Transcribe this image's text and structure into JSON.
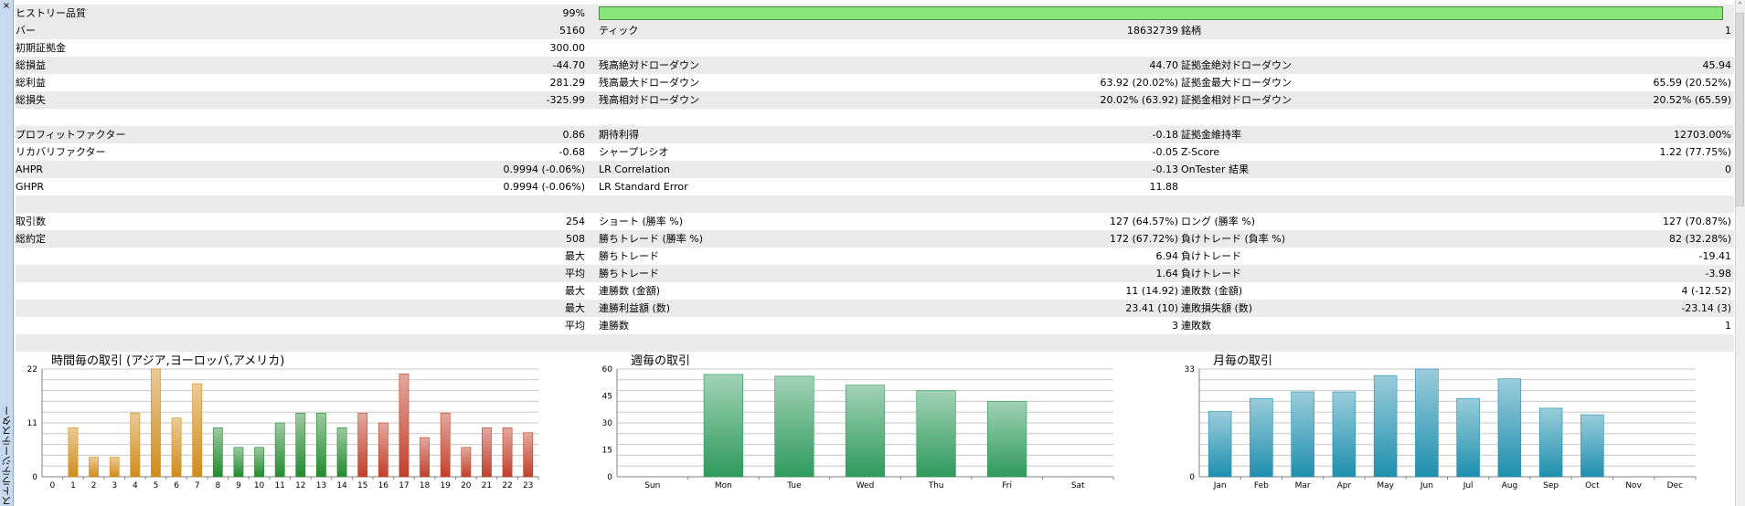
{
  "window": {
    "vertical_title": "ストラテジーテスター",
    "close_glyph": "×",
    "scroll_glyph": "⌃"
  },
  "stats": {
    "rows": [
      {
        "shade": true,
        "l1": "ヒストリー品質",
        "v1": "99%",
        "l2": "",
        "v2": "",
        "l3": "",
        "v3": "",
        "quality_bar": 99
      },
      {
        "shade": true,
        "l1": "バー",
        "v1": "5160",
        "l2": "ティック",
        "v2": "18632739",
        "l3": "銘柄",
        "v3": "1"
      },
      {
        "shade": false,
        "l1": "初期証拠金",
        "v1": "300.00",
        "l2": "",
        "v2": "",
        "l3": "",
        "v3": ""
      },
      {
        "shade": true,
        "l1": "総損益",
        "v1": "-44.70",
        "l2": "残高絶対ドローダウン",
        "v2": "44.70",
        "l3": "証拠金絶対ドローダウン",
        "v3": "45.94"
      },
      {
        "shade": false,
        "l1": "総利益",
        "v1": "281.29",
        "l2": "残高最大ドローダウン",
        "v2": "63.92 (20.02%)",
        "l3": "証拠金最大ドローダウン",
        "v3": "65.59 (20.52%)"
      },
      {
        "shade": true,
        "l1": "総損失",
        "v1": "-325.99",
        "l2": "残高相対ドローダウン",
        "v2": "20.02% (63.92)",
        "l3": "証拠金相対ドローダウン",
        "v3": "20.52% (65.59)"
      },
      {
        "shade": false,
        "l1": "",
        "v1": "",
        "l2": "",
        "v2": "",
        "l3": "",
        "v3": ""
      },
      {
        "shade": true,
        "l1": "プロフィットファクター",
        "v1": "0.86",
        "l2": "期待利得",
        "v2": "-0.18",
        "l3": "証拠金維持率",
        "v3": "12703.00%"
      },
      {
        "shade": false,
        "l1": "リカバリファクター",
        "v1": "-0.68",
        "l2": "シャープレシオ",
        "v2": "-0.05",
        "l3": "Z-Score",
        "v3": "1.22 (77.75%)"
      },
      {
        "shade": true,
        "l1": "AHPR",
        "v1": "0.9994 (-0.06%)",
        "l2": "LR Correlation",
        "v2": "-0.13",
        "l3": "OnTester 結果",
        "v3": "0"
      },
      {
        "shade": false,
        "l1": "GHPR",
        "v1": "0.9994 (-0.06%)",
        "l2": "LR Standard Error",
        "v2": "11.88",
        "l3": "",
        "v3": ""
      },
      {
        "shade": true,
        "l1": "",
        "v1": "",
        "l2": "",
        "v2": "",
        "l3": "",
        "v3": ""
      },
      {
        "shade": false,
        "l1": "取引数",
        "v1": "254",
        "l2": "ショート (勝率 %)",
        "v2": "127 (64.57%)",
        "l3": "ロング (勝率 %)",
        "v3": "127 (70.87%)"
      },
      {
        "shade": true,
        "l1": "総約定",
        "v1": "508",
        "l2": "勝ちトレード (勝率 %)",
        "v2": "172 (67.72%)",
        "l3": "負けトレード (負率 %)",
        "v3": "82 (32.28%)"
      },
      {
        "shade": false,
        "l1": "",
        "v1": "最大",
        "l2": "勝ちトレード",
        "v2": "6.94",
        "l3": "負けトレード",
        "v3": "-19.41"
      },
      {
        "shade": true,
        "l1": "",
        "v1": "平均",
        "l2": "勝ちトレード",
        "v2": "1.64",
        "l3": "負けトレード",
        "v3": "-3.98"
      },
      {
        "shade": false,
        "l1": "",
        "v1": "最大",
        "l2": "連勝数 (金額)",
        "v2": "11 (14.92)",
        "l3": "連敗数 (金額)",
        "v3": "4 (-12.52)"
      },
      {
        "shade": true,
        "l1": "",
        "v1": "最大",
        "l2": "連勝利益額 (数)",
        "v2": "23.41 (10)",
        "l3": "連敗損失額 (数)",
        "v3": "-23.14 (3)"
      },
      {
        "shade": false,
        "l1": "",
        "v1": "平均",
        "l2": "連勝数",
        "v2": "3",
        "l3": "連敗数",
        "v3": "1"
      },
      {
        "shade": true,
        "l1": "",
        "v1": "",
        "l2": "",
        "v2": "",
        "l3": "",
        "v3": ""
      }
    ]
  },
  "colors": {
    "hour_colors": [
      "#d08c1a",
      "#d08c1a",
      "#d08c1a",
      "#d08c1a",
      "#d08c1a",
      "#d08c1a",
      "#d08c1a",
      "#d08c1a",
      "#238a2e",
      "#238a2e",
      "#238a2e",
      "#238a2e",
      "#238a2e",
      "#238a2e",
      "#238a2e",
      "#c0402a",
      "#c0402a",
      "#c0402a",
      "#c0402a",
      "#c0402a",
      "#c0402a",
      "#c0402a",
      "#c0402a",
      "#c0402a"
    ],
    "week": "#2f9a5c",
    "month": "#1f8fae"
  },
  "chart_data": [
    {
      "type": "bar",
      "title": "時間毎の取引 (アジア,ヨーロッパ,アメリカ)",
      "categories": [
        "0",
        "1",
        "2",
        "3",
        "4",
        "5",
        "6",
        "7",
        "8",
        "9",
        "10",
        "11",
        "12",
        "13",
        "14",
        "15",
        "16",
        "17",
        "18",
        "19",
        "20",
        "21",
        "22",
        "23"
      ],
      "values": [
        0,
        10,
        4,
        4,
        13,
        22,
        12,
        19,
        10,
        6,
        6,
        11,
        13,
        13,
        10,
        13,
        11,
        21,
        8,
        13,
        6,
        10,
        10,
        9
      ],
      "yticks": [
        0,
        11,
        22
      ],
      "ylim": [
        0,
        22
      ]
    },
    {
      "type": "bar",
      "title": "週毎の取引",
      "categories": [
        "Sun",
        "Mon",
        "Tue",
        "Wed",
        "Thu",
        "Fri",
        "Sat"
      ],
      "values": [
        0,
        57,
        56,
        51,
        48,
        42,
        0
      ],
      "yticks": [
        0,
        15,
        30,
        45,
        60
      ],
      "ylim": [
        0,
        60
      ]
    },
    {
      "type": "bar",
      "title": "月毎の取引",
      "categories": [
        "Jan",
        "Feb",
        "Mar",
        "Apr",
        "May",
        "Jun",
        "Jul",
        "Aug",
        "Sep",
        "Oct",
        "Nov",
        "Dec"
      ],
      "values": [
        20,
        24,
        26,
        26,
        31,
        33,
        24,
        30,
        21,
        19,
        0,
        0
      ],
      "yticks": [
        0,
        33
      ],
      "ylim": [
        0,
        33
      ]
    }
  ]
}
